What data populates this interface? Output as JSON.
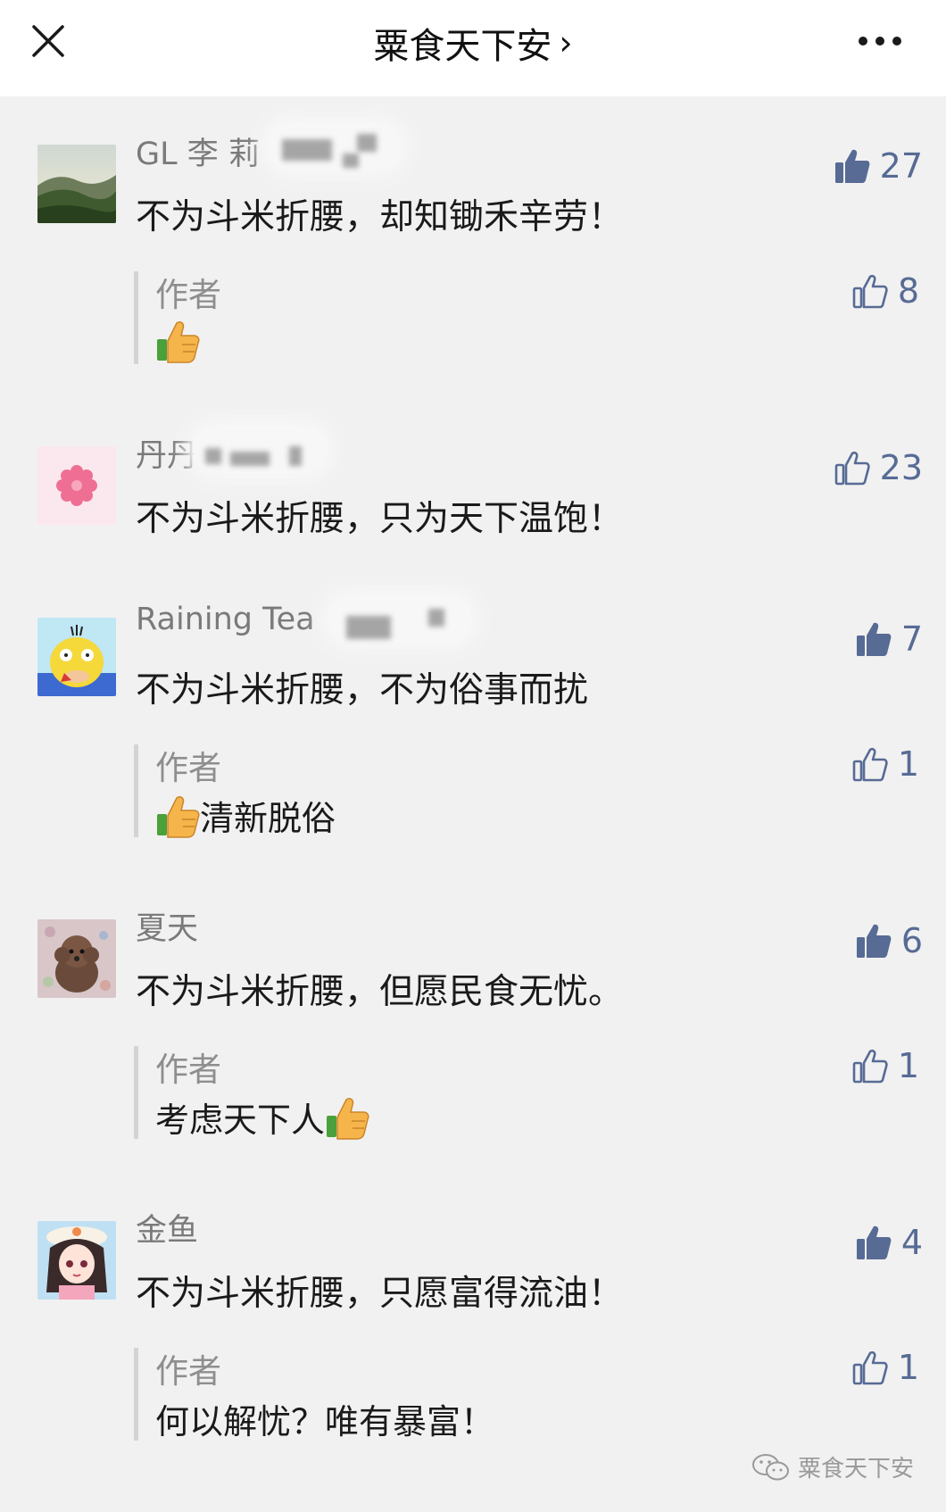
{
  "header": {
    "title": "粟食天下安",
    "chevron": "›",
    "close_icon": "close-icon",
    "more_icon": "more-icon"
  },
  "comments": [
    {
      "nickname": "GL 李 莉",
      "avatar": "mountain-landscape",
      "text": "不为斗米折腰，却知锄禾辛劳！",
      "likes": "27",
      "liked": true,
      "reply": {
        "author": "作者",
        "text": "",
        "emoji": "thumbs-up-emoji",
        "likes": "8"
      }
    },
    {
      "nickname": "丹丹",
      "avatar": "pink-flower",
      "text": "不为斗米折腰，只为天下温饱！",
      "likes": "23",
      "liked": false
    },
    {
      "nickname": "Raining Tea",
      "avatar": "psyduck-cartoon",
      "text": "不为斗米折腰，不为俗事而扰",
      "likes": "7",
      "liked": true,
      "reply": {
        "author": "作者",
        "text": "清新脱俗",
        "emoji": "thumbs-up-emoji",
        "likes": "1"
      }
    },
    {
      "nickname": "夏天",
      "avatar": "poodle-dog",
      "text": "不为斗米折腰，但愿民食无忧。",
      "likes": "6",
      "liked": true,
      "reply": {
        "author": "作者",
        "text": "考虑天下人",
        "emoji": "thumbs-up-emoji",
        "likes": "1"
      }
    },
    {
      "nickname": "金鱼",
      "avatar": "anime-girl",
      "text": "不为斗米折腰，只愿富得流油！",
      "likes": "4",
      "liked": true,
      "reply": {
        "author": "作者",
        "text": "何以解忧？唯有暴富！",
        "emoji": "",
        "likes": "1"
      }
    }
  ],
  "watermark": {
    "text": "粟食天下安",
    "icon": "wechat-icon"
  },
  "colors": {
    "accent": "#576b95",
    "background": "#f1f1f1",
    "header": "#ffffff",
    "nickname": "#7a7a7a"
  }
}
